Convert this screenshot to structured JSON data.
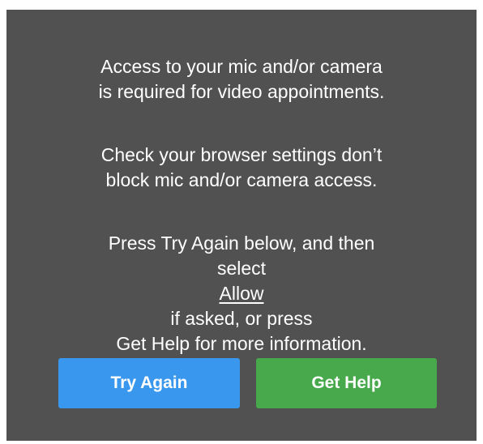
{
  "message": {
    "paragraph1": {
      "line1": "Access to your mic and/or camera",
      "line2": "is required for video appointments."
    },
    "paragraph2": {
      "line1": "Check your browser settings don’t",
      "line2": "block mic and/or camera access."
    },
    "paragraph3": {
      "line1": "Press Try Again below, and then",
      "line2_before": "select ",
      "line2_link": "Allow",
      "line2_after": " if asked, or press",
      "line3": "Get Help for more information."
    }
  },
  "buttons": {
    "try_again": "Try Again",
    "get_help": "Get Help"
  },
  "colors": {
    "panel_bg": "#515151",
    "try_again_bg": "#3a97ee",
    "get_help_bg": "#47a94b"
  }
}
